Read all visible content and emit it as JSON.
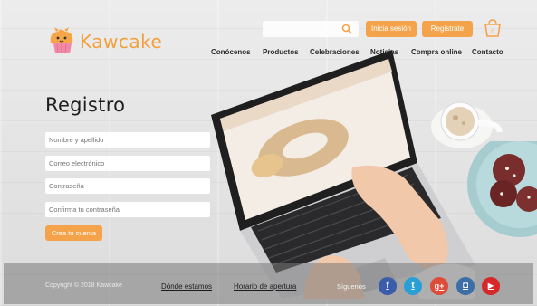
{
  "brand": {
    "name": "Kawcake",
    "accent": "#f5a34a"
  },
  "header": {
    "search": {
      "placeholder": "",
      "icon": "search-icon"
    },
    "login_label": "Inicia sesión",
    "register_label": "Registrate",
    "cart": {
      "icon": "cart-icon",
      "count": "0"
    }
  },
  "nav": {
    "items": [
      "Conócenos",
      "Productos",
      "Celebraciones",
      "Noticias",
      "Compra online",
      "Contacto"
    ]
  },
  "form": {
    "title": "Registro",
    "name_placeholder": "Nombre y apellido",
    "email_placeholder": "Correo electrónico",
    "password_placeholder": "Contraseña",
    "confirm_placeholder": "Confirma tu contraseña",
    "submit_label": "Crea tu cuenta"
  },
  "footer": {
    "copyright": "Copyright © 2018 Kawcake",
    "links": [
      "Dónde estamos",
      "Horario de apertura"
    ],
    "follow_label": "Síguenos",
    "social": [
      {
        "name": "facebook",
        "glyph": "f",
        "color": "#3b5ca8"
      },
      {
        "name": "twitter",
        "glyph": "t",
        "color": "#2a9fd6"
      },
      {
        "name": "google-plus",
        "glyph": "g+",
        "color": "#dd4b39"
      },
      {
        "name": "instagram",
        "glyph": "◘",
        "color": "#3d6ea8"
      },
      {
        "name": "youtube",
        "glyph": "▶",
        "color": "#d62828"
      }
    ]
  }
}
